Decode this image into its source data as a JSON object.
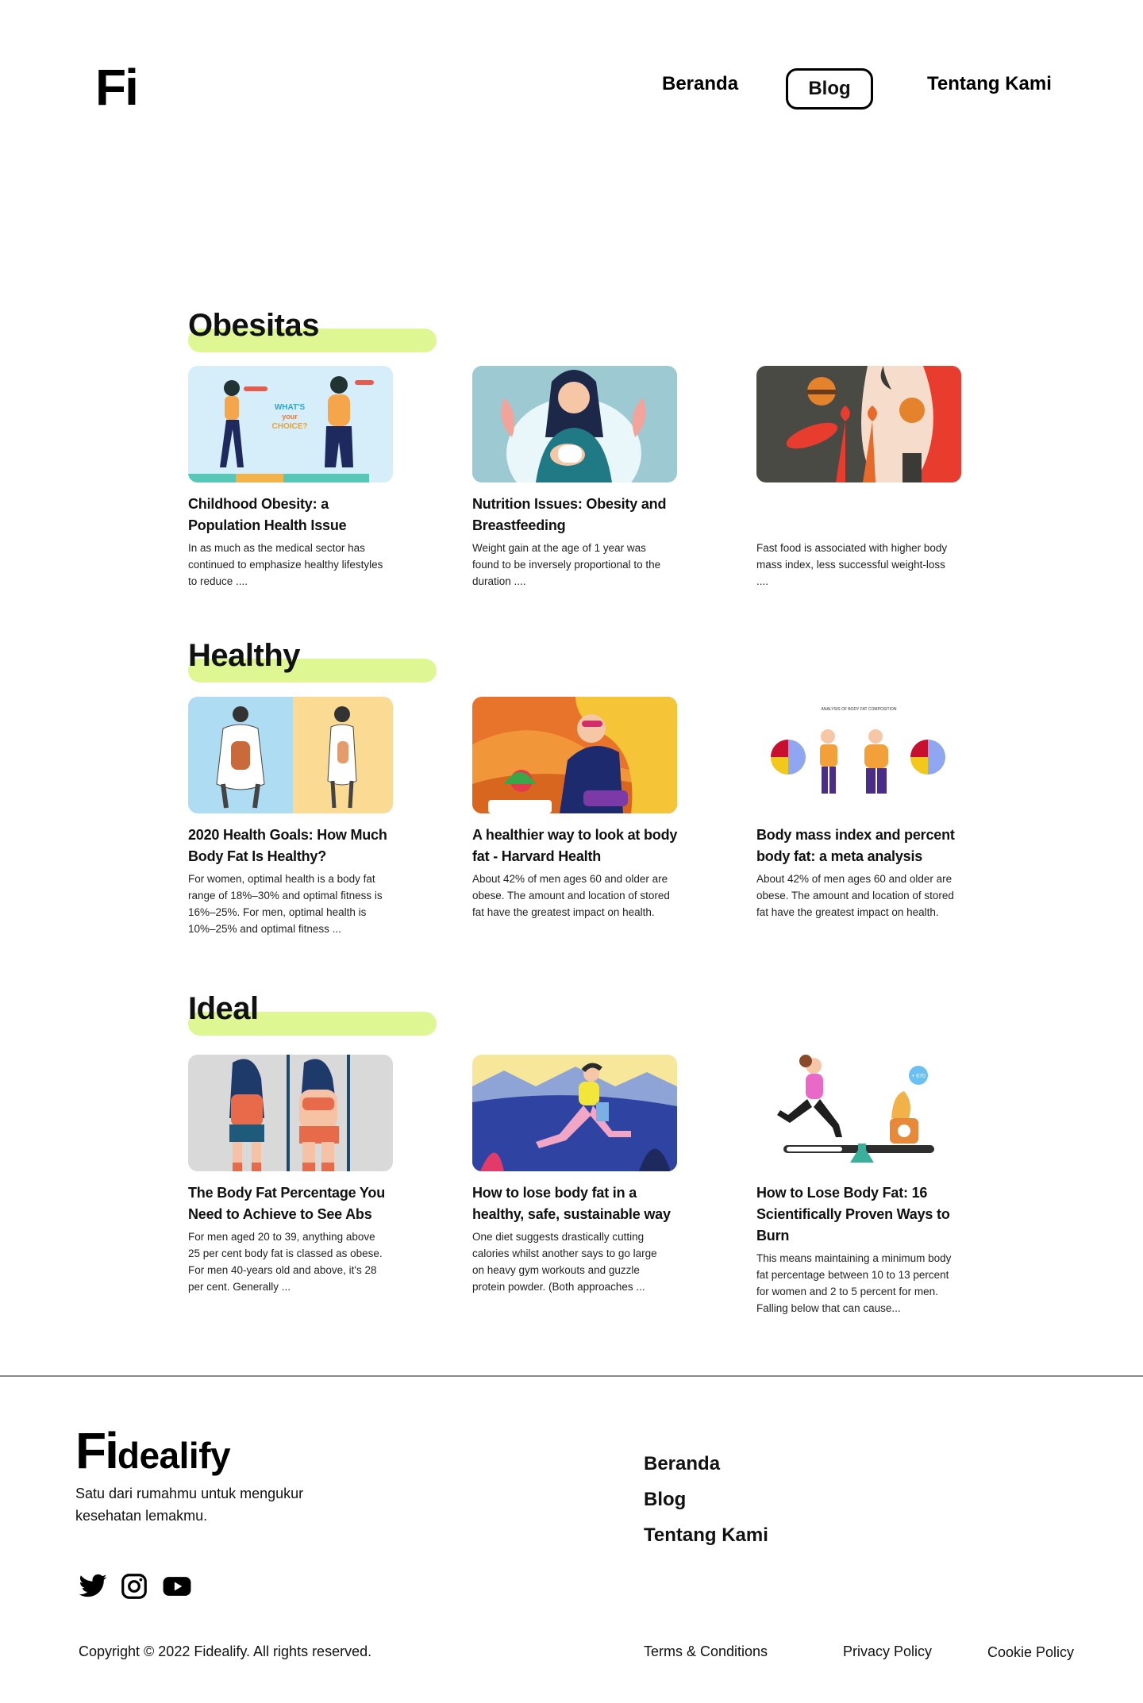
{
  "header": {
    "logo": "Fi",
    "nav": [
      {
        "label": "Beranda"
      },
      {
        "label": "Blog",
        "active": true
      },
      {
        "label": "Tentang Kami"
      }
    ]
  },
  "colors": {
    "highlight": "#dff792",
    "divider": "#8a8a8a"
  },
  "sections": [
    {
      "title": "Obesitas",
      "cards": [
        {
          "title": "Childhood Obesity: a Population Health Issue",
          "desc": "In as much as the medical sector has continued to emphasize healthy lifestyles to reduce ...."
        },
        {
          "title": "Nutrition Issues: Obesity and Breastfeeding",
          "desc": "Weight gain at the age of 1 year was found to be inversely proportional to the duration ...."
        },
        {
          "title": "",
          "desc": "Fast food is associated with higher body mass index, less successful weight-loss ...."
        }
      ]
    },
    {
      "title": "Healthy",
      "cards": [
        {
          "title": "2020 Health Goals: How Much Body Fat Is Healthy?",
          "desc": "For women, optimal health is a body fat range of 18%–30% and optimal fitness is 16%–25%. For men, optimal health is 10%–25% and optimal fitness ..."
        },
        {
          "title": "A healthier way to look at body fat - Harvard Health",
          "desc": "About 42% of men ages 60 and older are obese. The amount and location of stored fat have the greatest impact on health."
        },
        {
          "title": "Body mass index and percent body fat: a meta analysis",
          "desc": "About 42% of men ages 60 and older are obese. The amount and location of stored fat have the greatest impact on health."
        }
      ]
    },
    {
      "title": "Ideal",
      "cards": [
        {
          "title": "The Body Fat Percentage You Need to Achieve to See Abs",
          "desc": "For men aged 20 to 39, anything above 25 per cent body fat is classed as obese. For men 40-years old and above, it's 28 per cent. Generally ..."
        },
        {
          "title": "How to lose body fat in a healthy, safe, sustainable way",
          "desc": "One diet suggests drastically cutting calories whilst another says to go large on heavy gym workouts and guzzle protein powder. (Both approaches ..."
        },
        {
          "title": "How to Lose Body Fat: 16 Scientifically Proven Ways to Burn",
          "desc": "This means maintaining a minimum body fat percentage between 10 to 13 percent for women and 2 to 5 percent for men. Falling below that can cause..."
        }
      ]
    }
  ],
  "illustrations": {
    "choice_text": [
      "WHAT'S",
      "your",
      "CHOICE?"
    ],
    "chart_caption": "ANALYSIS OF BODY FAT COMPOSITION",
    "scale_badge": "+ 670"
  },
  "footer": {
    "logo_fi": "Fi",
    "logo_rest": "dealify",
    "tagline": "Satu dari rumahmu untuk mengukur kesehatan lemakmu.",
    "social": [
      "twitter-icon",
      "instagram-icon",
      "youtube-icon"
    ],
    "nav": [
      {
        "label": "Beranda"
      },
      {
        "label": "Blog"
      },
      {
        "label": "Tentang Kami"
      }
    ],
    "copyright": "Copyright © 2022 Fidealify. All rights reserved.",
    "legal": [
      {
        "label": "Terms & Conditions"
      },
      {
        "label": "Privacy Policy"
      },
      {
        "label": "Cookie Policy"
      }
    ]
  }
}
